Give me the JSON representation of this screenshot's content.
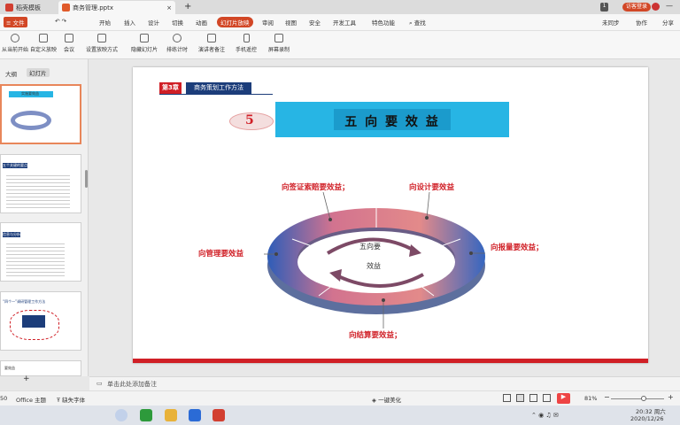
{
  "titlebar": {
    "tabs": [
      {
        "label": "稻壳模板",
        "color": "#d23f31"
      },
      {
        "label": "商务管理.pptx",
        "color": "#e05a2a"
      }
    ],
    "new_tab": "+",
    "window_badge": "1",
    "login": "访客登录"
  },
  "ribbon": {
    "menu": "≡ 文件",
    "tabs": [
      "开始",
      "插入",
      "设计",
      "切换",
      "动画",
      "幻灯片放映",
      "审阅",
      "视图",
      "安全",
      "开发工具",
      "特色功能"
    ],
    "active_tab": "幻灯片放映",
    "search": "查找",
    "right": [
      "未同步",
      "协作",
      "分享"
    ]
  },
  "toolbar": {
    "items": [
      "从当前开始",
      "自定义放映",
      "会议",
      "设置放映方式",
      "隐藏幻灯片",
      "排练计时",
      "演讲者备注",
      "手机遥控",
      "屏幕录制"
    ]
  },
  "leftpane": {
    "tabs": [
      "大纲",
      "幻灯片"
    ],
    "active": "幻灯片",
    "thumbs": [
      {
        "title": "实施要效益"
      },
      {
        "title": "五个关键的要点"
      },
      {
        "title": "信息与分析"
      },
      {
        "title": "“四个一”调研管理工作方法"
      },
      {
        "title": "要效益"
      }
    ],
    "add_label": "+"
  },
  "slide": {
    "chapter": "第3章",
    "section": "商务策划工作方法",
    "badge": "5",
    "title": "五 向 要 效 益",
    "center": [
      "五向要",
      "效益"
    ],
    "labels": {
      "top_left": "向签证索赔要效益；",
      "top_right": "向设计要效益",
      "right": "向报量要效益；",
      "left": "向管理要效益",
      "bottom": "向结算要效益；"
    },
    "colors": {
      "accent_red": "#d01f26",
      "title_cyan": "#27b5e4",
      "navy": "#1c3d7a"
    }
  },
  "notes": {
    "placeholder": "单击此处添加备注"
  },
  "statusbar": {
    "page": "50",
    "theme": "Office 主题",
    "font": "缺失字体",
    "beautify": "一键美化",
    "zoom": "81%"
  },
  "taskbar": {
    "time": "20:32 周六",
    "date": "2020/12/26"
  }
}
